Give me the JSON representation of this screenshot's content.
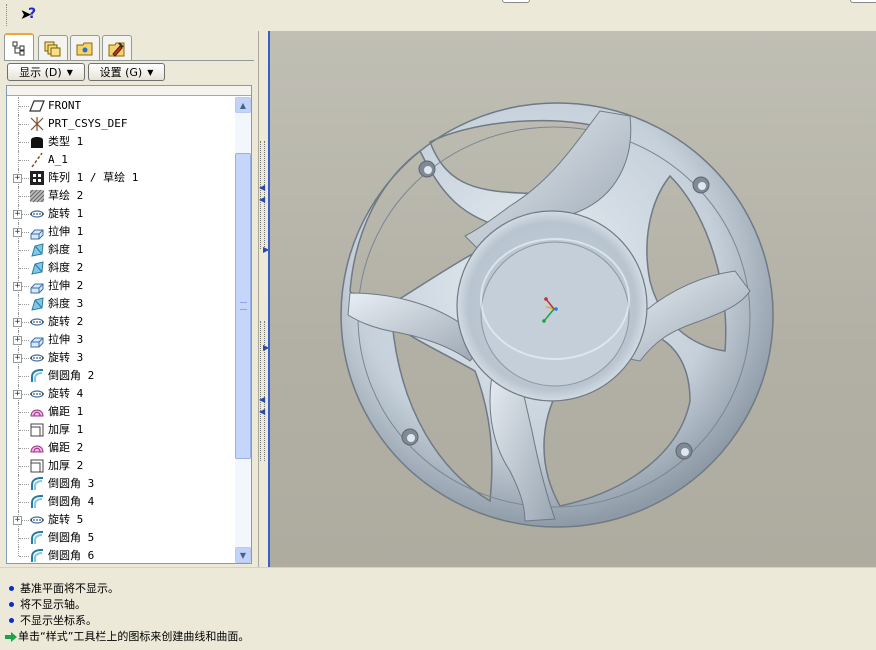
{
  "toolbar": {
    "whats_this_icon": "context-help-icon"
  },
  "left_panel": {
    "tabs": [
      {
        "icon": "model-tree-icon"
      },
      {
        "icon": "layers-icon"
      },
      {
        "icon": "folder-browser-icon"
      },
      {
        "icon": "favorites-icon"
      }
    ],
    "show_button": "显示 (D)",
    "settings_button": "设置 (G)",
    "tree_items": [
      {
        "label": "FRONT",
        "icon": "datum-plane-icon",
        "expandable": false
      },
      {
        "label": "PRT_CSYS_DEF",
        "icon": "coordinate-system-icon",
        "expandable": false
      },
      {
        "label": "类型 1",
        "icon": "type-feature-icon",
        "expandable": false
      },
      {
        "label": "A_1",
        "icon": "datum-axis-icon",
        "expandable": false
      },
      {
        "label": "阵列 1 / 草绘 1",
        "icon": "pattern-icon",
        "expandable": true
      },
      {
        "label": "草绘 2",
        "icon": "sketch-icon",
        "expandable": false
      },
      {
        "label": "旋转 1",
        "icon": "revolve-icon",
        "expandable": true
      },
      {
        "label": "拉伸 1",
        "icon": "extrude-icon",
        "expandable": true
      },
      {
        "label": "斜度 1",
        "icon": "draft-icon",
        "expandable": false
      },
      {
        "label": "斜度 2",
        "icon": "draft-icon",
        "expandable": false
      },
      {
        "label": "拉伸 2",
        "icon": "extrude-icon",
        "expandable": true
      },
      {
        "label": "斜度 3",
        "icon": "draft-icon",
        "expandable": false
      },
      {
        "label": "旋转 2",
        "icon": "revolve-icon",
        "expandable": true
      },
      {
        "label": "拉伸 3",
        "icon": "extrude-icon",
        "expandable": true
      },
      {
        "label": "旋转 3",
        "icon": "revolve-icon",
        "expandable": true
      },
      {
        "label": "倒圆角 2",
        "icon": "round-icon",
        "expandable": false
      },
      {
        "label": "旋转 4",
        "icon": "revolve-icon",
        "expandable": true
      },
      {
        "label": "偏距 1",
        "icon": "offset-icon",
        "expandable": false
      },
      {
        "label": "加厚 1",
        "icon": "thicken-icon",
        "expandable": false
      },
      {
        "label": "偏距 2",
        "icon": "offset-icon",
        "expandable": false
      },
      {
        "label": "加厚 2",
        "icon": "thicken-icon",
        "expandable": false
      },
      {
        "label": "倒圆角 3",
        "icon": "round-icon",
        "expandable": false
      },
      {
        "label": "倒圆角 4",
        "icon": "round-icon",
        "expandable": false
      },
      {
        "label": "旋转 5",
        "icon": "revolve-icon",
        "expandable": true
      },
      {
        "label": "倒圆角 5",
        "icon": "round-icon",
        "expandable": false
      },
      {
        "label": "倒圆角 6",
        "icon": "round-icon",
        "expandable": false
      }
    ]
  },
  "messages": [
    {
      "text": "基准平面将不显示。",
      "type": "info"
    },
    {
      "text": "将不显示轴。",
      "type": "info"
    },
    {
      "text": "不显示坐标系。",
      "type": "info"
    },
    {
      "text": "单击“样式”工具栏上的图标来创建曲线和曲面。",
      "type": "prompt"
    }
  ],
  "colors": {
    "model_surface": "#c8d2dc",
    "viewport_background": "#b5b3a8",
    "info_bullet": "#0a2bc8",
    "prompt_arrow": "#1aa34a"
  }
}
